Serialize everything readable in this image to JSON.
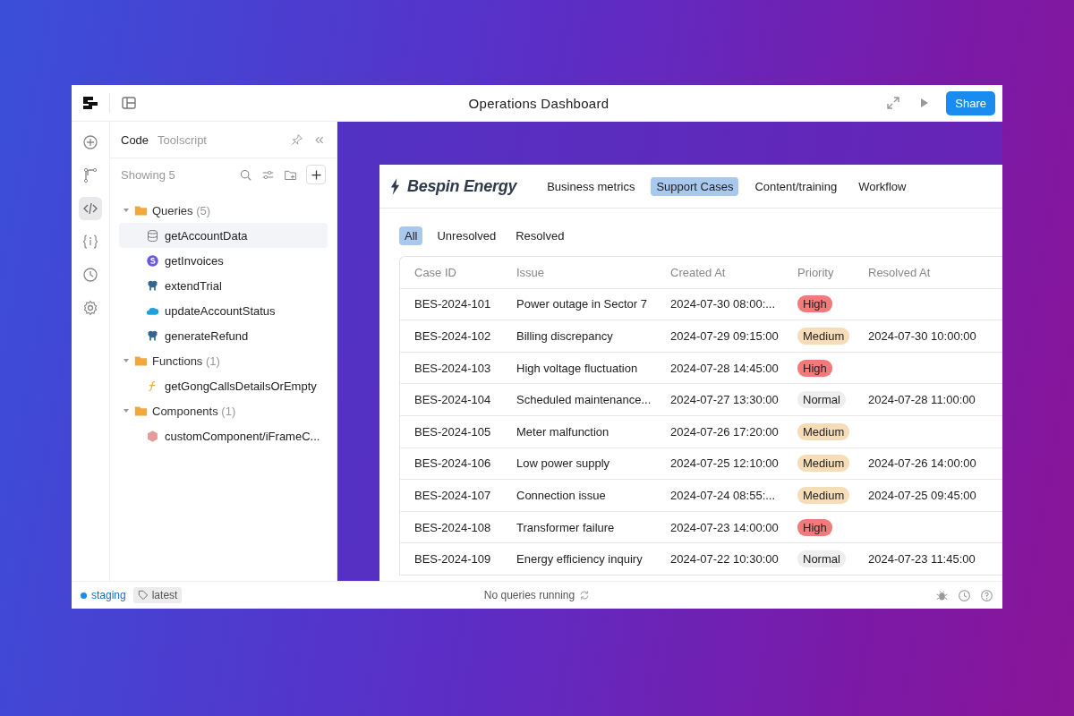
{
  "window": {
    "title": "Operations Dashboard",
    "share_button": "Share"
  },
  "rail": [
    {
      "kind": "plus",
      "selected": false
    },
    {
      "kind": "branch",
      "selected": false
    },
    {
      "kind": "code",
      "selected": true
    },
    {
      "kind": "state",
      "selected": false
    },
    {
      "kind": "history",
      "selected": false
    },
    {
      "kind": "settings",
      "selected": false
    }
  ],
  "panel": {
    "tabs": [
      {
        "label": "Code",
        "selected": true
      },
      {
        "label": "Toolscript",
        "selected": false
      }
    ],
    "showing": "Showing 5",
    "tree": [
      {
        "label": "Queries",
        "count": "(5)",
        "expanded": true,
        "children": [
          {
            "label": "getAccountData",
            "kind": "database",
            "selected": true
          },
          {
            "label": "getInvoices",
            "kind": "stripe",
            "selected": false
          },
          {
            "label": "extendTrial",
            "kind": "postgres",
            "selected": false
          },
          {
            "label": "updateAccountStatus",
            "kind": "salesforce",
            "selected": false
          },
          {
            "label": "generateRefund",
            "kind": "postgres",
            "selected": false
          }
        ]
      },
      {
        "label": "Functions",
        "count": "(1)",
        "expanded": true,
        "children": [
          {
            "label": "getGongCallsDetailsOrEmpty",
            "kind": "function",
            "selected": false
          }
        ]
      },
      {
        "label": "Components",
        "count": "(1)",
        "expanded": true,
        "children": [
          {
            "label": "customComponent/iFrameC...",
            "kind": "component",
            "selected": false
          }
        ]
      }
    ]
  },
  "app": {
    "brand": "Bespin Energy",
    "nav": [
      {
        "label": "Business metrics",
        "selected": false
      },
      {
        "label": "Support Cases",
        "selected": true
      },
      {
        "label": "Content/training",
        "selected": false
      },
      {
        "label": "Workflow",
        "selected": false
      }
    ],
    "filters": [
      {
        "label": "All",
        "selected": true
      },
      {
        "label": "Unresolved",
        "selected": false
      },
      {
        "label": "Resolved",
        "selected": false
      }
    ],
    "table": {
      "columns": [
        "Case ID",
        "Issue",
        "Created At",
        "Priority",
        "Resolved At"
      ],
      "rows": [
        {
          "case_id": "BES-2024-101",
          "issue": "Power outage in Sector 7",
          "created_at": "2024-07-30 08:00:...",
          "priority": "High",
          "kind": "high",
          "resolved_at": ""
        },
        {
          "case_id": "BES-2024-102",
          "issue": "Billing discrepancy",
          "created_at": "2024-07-29 09:15:00",
          "priority": "Medium",
          "kind": "medium",
          "resolved_at": "2024-07-30 10:00:00"
        },
        {
          "case_id": "BES-2024-103",
          "issue": "High voltage fluctuation",
          "created_at": "2024-07-28 14:45:00",
          "priority": "High",
          "kind": "high",
          "resolved_at": ""
        },
        {
          "case_id": "BES-2024-104",
          "issue": "Scheduled maintenance...",
          "created_at": "2024-07-27 13:30:00",
          "priority": "Normal",
          "kind": "normal",
          "resolved_at": "2024-07-28 11:00:00"
        },
        {
          "case_id": "BES-2024-105",
          "issue": "Meter malfunction",
          "created_at": "2024-07-26 17:20:00",
          "priority": "Medium",
          "kind": "medium",
          "resolved_at": ""
        },
        {
          "case_id": "BES-2024-106",
          "issue": "Low power supply",
          "created_at": "2024-07-25 12:10:00",
          "priority": "Medium",
          "kind": "medium",
          "resolved_at": "2024-07-26 14:00:00"
        },
        {
          "case_id": "BES-2024-107",
          "issue": "Connection issue",
          "created_at": "2024-07-24 08:55:...",
          "priority": "Medium",
          "kind": "medium",
          "resolved_at": "2024-07-25 09:45:00"
        },
        {
          "case_id": "BES-2024-108",
          "issue": "Transformer failure",
          "created_at": "2024-07-23 14:00:00",
          "priority": "High",
          "kind": "high",
          "resolved_at": ""
        },
        {
          "case_id": "BES-2024-109",
          "issue": "Energy efficiency inquiry",
          "created_at": "2024-07-22 10:30:00",
          "priority": "Normal",
          "kind": "normal",
          "resolved_at": "2024-07-23 11:45:00"
        }
      ]
    }
  },
  "status_bar": {
    "environment": "staging",
    "tag": "latest",
    "message": "No queries running"
  }
}
